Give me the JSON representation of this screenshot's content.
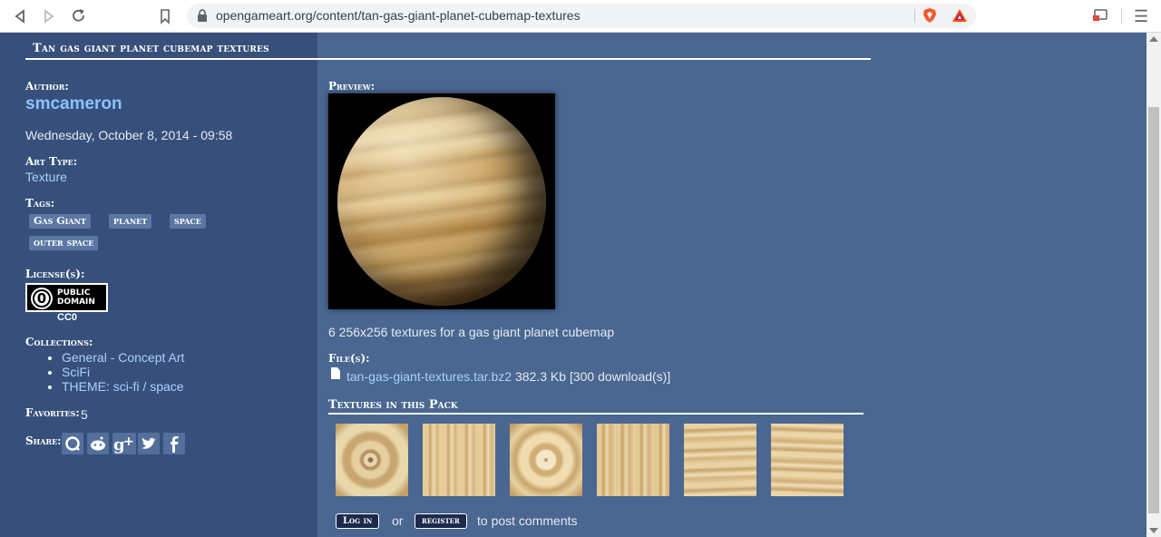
{
  "browser": {
    "url": "opengameart.org/content/tan-gas-giant-planet-cubemap-textures",
    "icons": [
      "back-icon",
      "forward-icon",
      "reload-icon",
      "bookmark-icon",
      "lock-icon",
      "brave-shields-icon",
      "brave-rewards-icon",
      "cast-icon",
      "menu-icon"
    ]
  },
  "page": {
    "title": "Tan gas giant planet cubemap textures"
  },
  "sidebar": {
    "author_label": "Author:",
    "author_name": "smcameron",
    "date": "Wednesday, October 8, 2014 - 09:58",
    "art_type_label": "Art Type:",
    "art_type_value": "Texture",
    "tags_label": "Tags:",
    "tags": [
      "Gas Giant",
      "planet",
      "space",
      "outer space"
    ],
    "license_label": "License(s):",
    "license_badge_line1": "PUBLIC",
    "license_badge_line2": "DOMAIN",
    "license_name": "CC0",
    "collections_label": "Collections:",
    "collections": [
      "General - Concept Art",
      "SciFi",
      "THEME: sci-fi / space"
    ],
    "favorites_label": "Favorites:",
    "favorites_count": "5",
    "share_label": "Share:",
    "share_icons": [
      "share-icon",
      "reddit-icon",
      "google-plus-icon",
      "twitter-icon",
      "facebook-icon"
    ]
  },
  "main": {
    "preview_label": "Preview:",
    "description": "6 256x256 textures for a gas giant planet cubemap",
    "files_label": "File(s):",
    "file_name": "tan-gas-giant-textures.tar.bz2",
    "file_info": "382.3 Kb [300 download(s)]",
    "textures_label": "Textures in this Pack",
    "texture_count": 6,
    "login_label": "Log in",
    "or_text": "or",
    "register_label": "register",
    "post_comments_text": "to post comments"
  }
}
